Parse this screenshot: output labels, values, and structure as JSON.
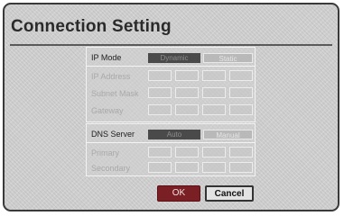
{
  "dialog": {
    "title": "Connection Setting"
  },
  "ip_section": {
    "ip_mode_label": "IP Mode",
    "ip_mode_options": [
      "Dynamic",
      "Static"
    ],
    "fields": [
      {
        "label": "IP Address"
      },
      {
        "label": "Subnet Mask"
      },
      {
        "label": "Gateway"
      }
    ]
  },
  "dns_section": {
    "dns_label": "DNS Server",
    "dns_options": [
      "Auto",
      "Manual"
    ],
    "fields": [
      {
        "label": "Primary"
      },
      {
        "label": "Secondary"
      }
    ]
  },
  "buttons": {
    "ok_label": "OK",
    "cancel_label": "Cancel"
  },
  "colors": {
    "ok_button": "#7a1f24",
    "selected_option": "#4a4a4a",
    "frame_border": "#3a3a3a"
  }
}
